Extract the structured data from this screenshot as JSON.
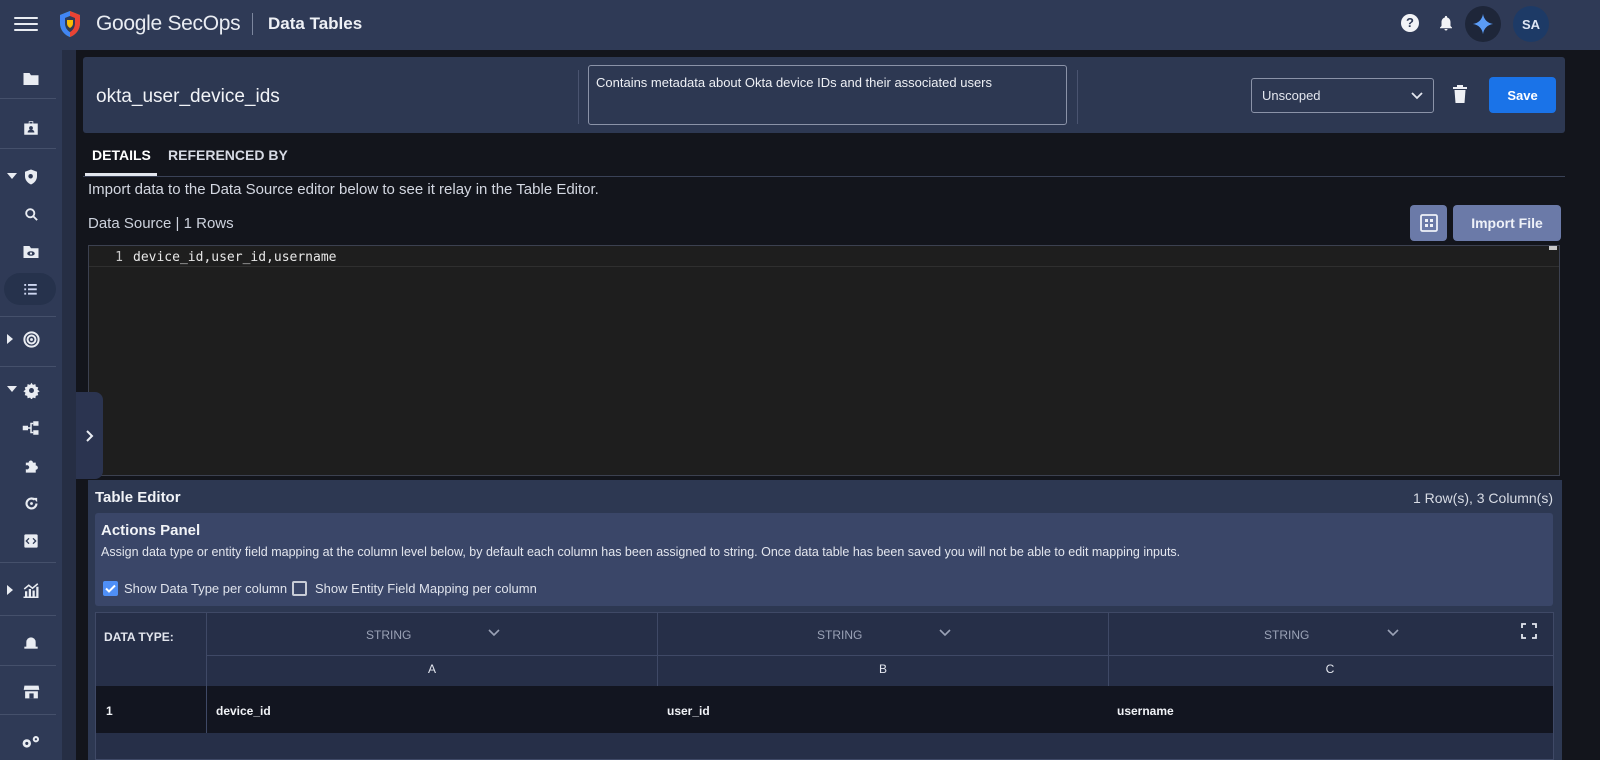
{
  "app": {
    "brand": "Google SecOps",
    "page_title": "Data Tables",
    "help_glyph": "?",
    "avatar_initials": "SA",
    "accent_color": "#1a73e8"
  },
  "sidebar": {
    "icons": [
      "folder-icon",
      "case-icon",
      "detection-shield-icon",
      "search-icon",
      "folder-eye-icon",
      "list-icon",
      "radar-icon",
      "settings-gear-icon",
      "workflow-icon",
      "puzzle-icon",
      "refresh-icon",
      "code-icon",
      "analytics-icon",
      "alert-bell-icon",
      "marketplace-icon",
      "settings-icon"
    ]
  },
  "table": {
    "name": "okta_user_device_ids",
    "description": "Contains metadata about Okta device IDs and their associated users",
    "scope": "Unscoped",
    "save_label": "Save"
  },
  "tabs": [
    "DETAILS",
    "REFERENCED BY"
  ],
  "details": {
    "intro": "Import data to the Data Source editor below to see it relay in the Table Editor.",
    "data_source_label": "Data Source | 1 Rows",
    "import_label": "Import File"
  },
  "editor": {
    "lines": [
      {
        "number": "1",
        "text": "device_id,user_id,username"
      }
    ]
  },
  "table_editor": {
    "title": "Table Editor",
    "count": "1 Row(s), 3 Column(s)",
    "actions_title": "Actions Panel",
    "actions_desc": "Assign data type or entity field mapping at the column level below, by default each column has been assigned to string. Once data table has been saved you will not be able to edit mapping inputs.",
    "show_data_type_label": "Show Data Type per column",
    "show_data_type_checked": true,
    "show_entity_mapping_label": "Show Entity Field Mapping per column",
    "show_entity_mapping_checked": false,
    "data_type_header": "DATA TYPE:",
    "columns": [
      {
        "type": "STRING",
        "letter": "A"
      },
      {
        "type": "STRING",
        "letter": "B"
      },
      {
        "type": "STRING",
        "letter": "C"
      }
    ],
    "rows": [
      {
        "number": "1",
        "cells": [
          "device_id",
          "user_id",
          "username"
        ]
      }
    ]
  }
}
